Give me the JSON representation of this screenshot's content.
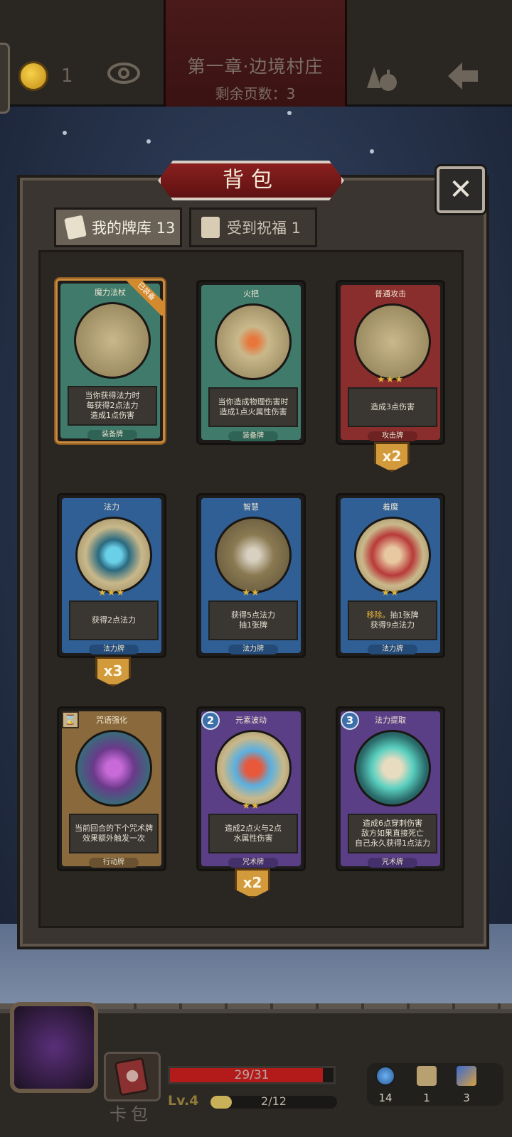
{
  "topbar": {
    "coins": "1",
    "chapter_title": "第一章·边境村庄",
    "pages_left": "剩余页数：3"
  },
  "panel": {
    "title": "背包",
    "tabs": [
      {
        "label": "我的牌库 13"
      },
      {
        "label": "受到祝福 1"
      }
    ]
  },
  "cards": [
    {
      "name": "魔力法杖",
      "equipped_tag": "已装备",
      "desc": [
        "当你获得法力时",
        "每获得2点法力",
        "造成1点伤害"
      ],
      "type": "装备牌",
      "stars": "",
      "count": ""
    },
    {
      "name": "火把",
      "desc": [
        "当你造成物理伤害时",
        "造成1点火属性伤害"
      ],
      "type": "装备牌",
      "stars": "",
      "count": ""
    },
    {
      "name": "普通攻击",
      "desc": [
        "造成3点伤害"
      ],
      "type": "攻击牌",
      "stars": "★★★",
      "count": "x2"
    },
    {
      "name": "法力",
      "desc": [
        "获得2点法力"
      ],
      "type": "法力牌",
      "stars": "★★★",
      "count": "x3"
    },
    {
      "name": "智慧",
      "desc": [
        "获得5点法力",
        "抽1张牌"
      ],
      "type": "法力牌",
      "stars": "★★",
      "count": ""
    },
    {
      "name": "着魔",
      "desc_highlight": "移除。",
      "desc": [
        "抽1张牌",
        "获得9点法力"
      ],
      "type": "法力牌",
      "stars": "★★",
      "count": ""
    },
    {
      "name": "咒语强化",
      "desc": [
        "当前回合的下个咒术牌",
        "效果额外触发一次"
      ],
      "type": "行动牌",
      "stars": "",
      "count": "",
      "cost": "⌛"
    },
    {
      "name": "元素波动",
      "desc": [
        "造成2点火与2点",
        "水属性伤害"
      ],
      "type": "咒术牌",
      "stars": "★★",
      "count": "x2",
      "cost": "2"
    },
    {
      "name": "法力提取",
      "desc": [
        "造成6点穿刺伤害",
        "敌方如果直接死亡",
        "自己永久获得1点法力"
      ],
      "type": "咒术牌",
      "stars": "",
      "count": "",
      "cost": "3"
    }
  ],
  "bottombar": {
    "deck_label": "卡包",
    "hp_text": "29/31",
    "hp_fraction": 0.935,
    "level": "Lv.4",
    "xp_text": "2/12",
    "xp_fraction": 0.167,
    "resources": [
      {
        "icon": "mana-potion-icon",
        "value": "14"
      },
      {
        "icon": "hourglass-icon",
        "value": "1"
      },
      {
        "icon": "cards-icon",
        "value": "3"
      }
    ]
  },
  "colors": {
    "equip_frame": "#3f7a6a",
    "attack_frame": "#8a2d2d",
    "mana_frame": "#2f5f95",
    "action_frame": "#8a6a3c",
    "spell_frame": "#5a3f86"
  }
}
